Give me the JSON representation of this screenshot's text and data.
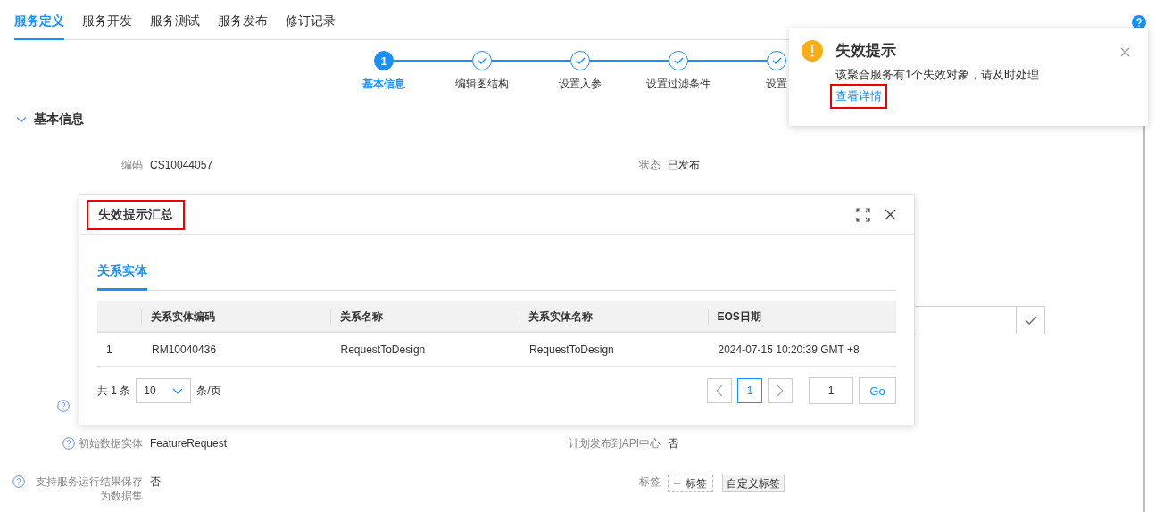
{
  "top_tabs": [
    {
      "label": "服务定义",
      "selected": true
    },
    {
      "label": "服务开发",
      "selected": false
    },
    {
      "label": "服务测试",
      "selected": false
    },
    {
      "label": "服务发布",
      "selected": false
    },
    {
      "label": "修订记录",
      "selected": false
    }
  ],
  "steps": [
    {
      "label": "基本信息",
      "current": true,
      "number": "1"
    },
    {
      "label": "编辑图结构",
      "current": false
    },
    {
      "label": "设置入参",
      "current": false
    },
    {
      "label": "设置过滤条件",
      "current": false
    },
    {
      "label": "设置",
      "current": false
    }
  ],
  "section": {
    "title": "基本信息",
    "expanded": true
  },
  "form_rows": [
    {
      "left": {
        "label": "编码",
        "value": "CS10044057",
        "help": false
      },
      "right": {
        "kind": "text",
        "label": "状态",
        "value": "已发布"
      }
    },
    {
      "right": {
        "kind": "input"
      }
    },
    {
      "left": {
        "help": true
      }
    },
    {
      "left": {
        "label": "初始数据实体",
        "value": "FeatureRequest",
        "help": true
      },
      "right": {
        "kind": "text",
        "label": "计划发布到API中心",
        "value": "否"
      }
    },
    {
      "left": {
        "label": "支持服务运行结果保存为数据集",
        "value": "否",
        "help": true
      },
      "right": {
        "kind": "tags",
        "label": "标签",
        "add_label": "标签",
        "custom_label": "自定义标签"
      }
    }
  ],
  "dialog": {
    "title": "失效提示汇总",
    "title_highlighted": true,
    "tabs": [
      {
        "label": "关系实体",
        "selected": true
      }
    ],
    "table": {
      "columns": [
        "关系实体编码",
        "关系名称",
        "关系实体名称",
        "EOS日期"
      ],
      "rows": [
        {
          "index": "1",
          "cells": [
            "RM10040436",
            "RequestToDesign",
            "RequestToDesign",
            "2024-07-15 10:20:39 GMT +8"
          ]
        }
      ]
    },
    "pagination": {
      "total": "共 1 条",
      "page_size": "10",
      "per_page": "条/页",
      "pages": [
        {
          "label": "1",
          "selected": true
        }
      ],
      "jump": "1",
      "go": "Go"
    }
  },
  "notification": {
    "title": "失效提示",
    "message": "该聚合服务有1个失效对象，请及时处理",
    "link": "查看详情",
    "link_highlighted": true
  }
}
